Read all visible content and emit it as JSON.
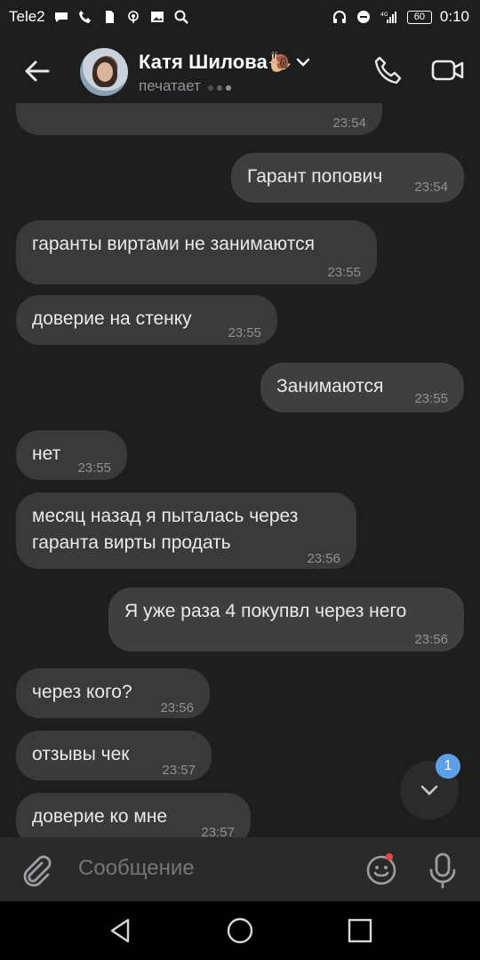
{
  "statusbar": {
    "carrier": "Tele2",
    "battery": "60",
    "time": "0:10"
  },
  "header": {
    "contact_name": "Катя Шилова🐌",
    "status": "печатает"
  },
  "messages": [
    {
      "text": "",
      "time": "23:54",
      "direction": "in"
    },
    {
      "text": "Гарант попович",
      "time": "23:54",
      "direction": "out"
    },
    {
      "text": "гаранты виртами не занимаются",
      "time": "23:55",
      "direction": "in"
    },
    {
      "text": "доверие на стенку",
      "time": "23:55",
      "direction": "in"
    },
    {
      "text": "Занимаются",
      "time": "23:55",
      "direction": "out"
    },
    {
      "text": "нет",
      "time": "23:55",
      "direction": "in"
    },
    {
      "text": "месяц назад я пыталась через\nгаранта вирты продать",
      "time": "23:56",
      "direction": "in"
    },
    {
      "text": "Я уже раза 4 покупвл через него",
      "time": "23:56",
      "direction": "out"
    },
    {
      "text": "через кого?",
      "time": "23:56",
      "direction": "in"
    },
    {
      "text": "отзывы чек",
      "time": "23:57",
      "direction": "in"
    },
    {
      "text": "доверие ко мне",
      "time": "23:57",
      "direction": "in"
    }
  ],
  "scroll_button": {
    "unread_count": "1"
  },
  "composer": {
    "placeholder": "Сообщение"
  },
  "colors": {
    "background": "#1e1e1e",
    "bubble": "#3a3a3b",
    "badge": "#5da0e8",
    "notification_dot": "#e64646"
  },
  "icons": [
    "back-arrow-icon",
    "phone-icon",
    "video-camera-icon",
    "chevron-down-icon",
    "paperclip-icon",
    "emoji-icon",
    "microphone-icon",
    "nav-back-icon",
    "nav-home-icon",
    "nav-recents-icon"
  ]
}
